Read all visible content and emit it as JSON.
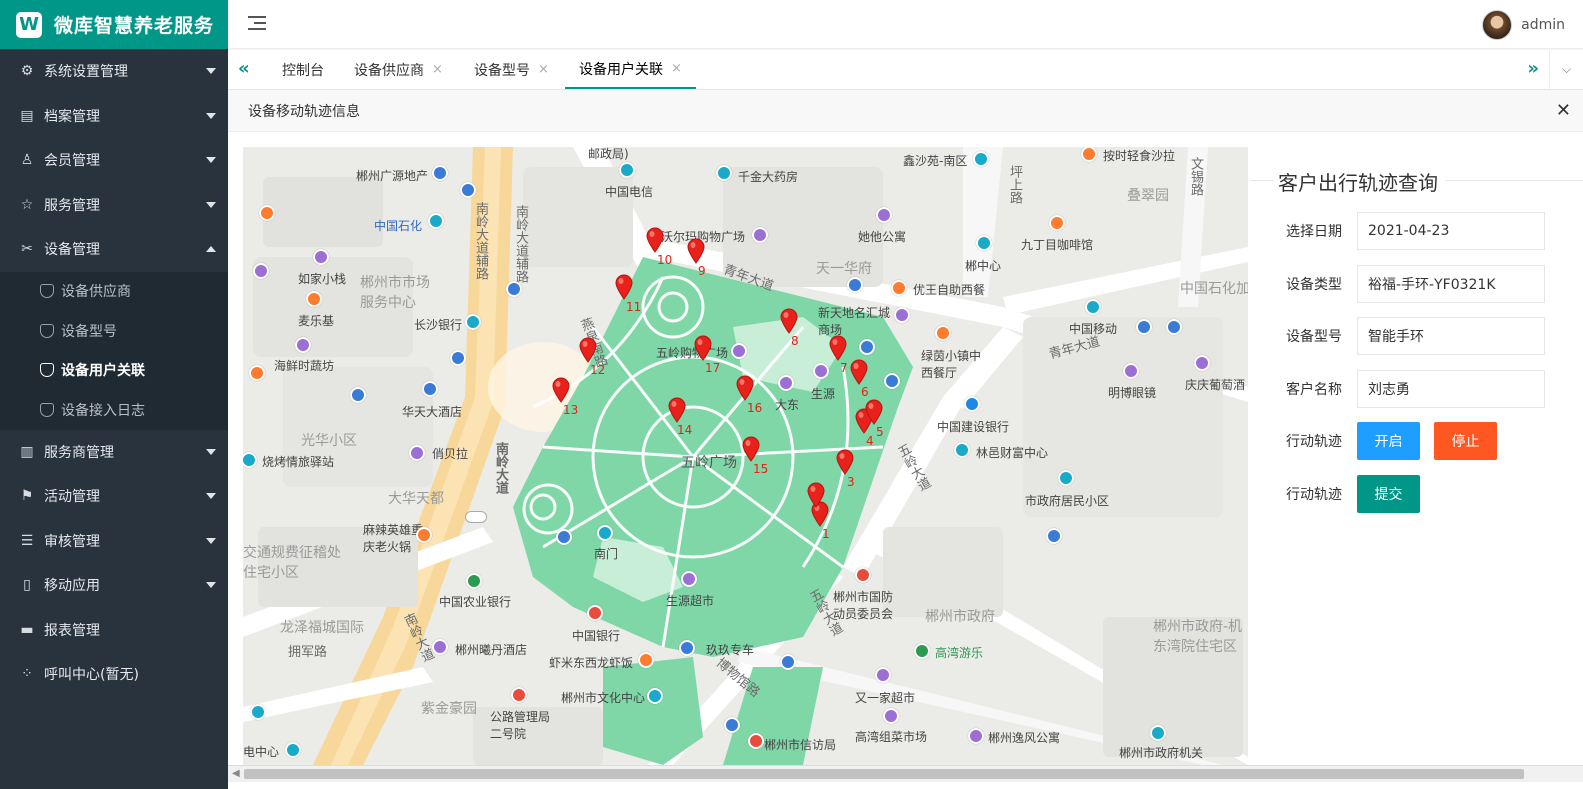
{
  "app": {
    "title": "微库智慧养老服务",
    "logo_letter": "W"
  },
  "sidebar": {
    "items": [
      {
        "label": "系统设置管理",
        "icon": "gear-icon"
      },
      {
        "label": "档案管理",
        "icon": "archive-icon"
      },
      {
        "label": "会员管理",
        "icon": "user-icon"
      },
      {
        "label": "服务管理",
        "icon": "star-icon"
      },
      {
        "label": "设备管理",
        "icon": "tools-icon"
      },
      {
        "label": "服务商管理",
        "icon": "document-icon"
      },
      {
        "label": "活动管理",
        "icon": "flag-icon"
      },
      {
        "label": "审核管理",
        "icon": "list-icon"
      },
      {
        "label": "移动应用",
        "icon": "mobile-icon"
      },
      {
        "label": "报表管理",
        "icon": "report-icon"
      },
      {
        "label": "呼叫中心(暂无)",
        "icon": "spinner-icon"
      }
    ],
    "submenu": [
      {
        "label": "设备供应商"
      },
      {
        "label": "设备型号"
      },
      {
        "label": "设备用户关联"
      },
      {
        "label": "设备接入日志"
      }
    ]
  },
  "header": {
    "user_name": "admin"
  },
  "tabs": [
    {
      "label": "控制台"
    },
    {
      "label": "设备供应商"
    },
    {
      "label": "设备型号"
    },
    {
      "label": "设备用户关联"
    }
  ],
  "panel": {
    "title": "设备移动轨迹信息"
  },
  "form": {
    "title": "客户出行轨迹查询",
    "date_label": "选择日期",
    "date_value": "2021-04-23",
    "type_label": "设备类型",
    "type_value": "裕福-手环-YF0321K",
    "model_label": "设备型号",
    "model_value": "智能手环",
    "customer_label": "客户名称",
    "customer_value": "刘志勇",
    "track_label": "行动轨迹",
    "start_btn": "开启",
    "stop_btn": "停止",
    "track_label2": "行动轨迹",
    "submit_btn": "提交"
  },
  "map": {
    "labels": [
      "邮政局)",
      "郴州广源地产",
      "中国电信",
      "千金大药房",
      "鑫沙苑-南区",
      "按时轻食沙拉",
      "中国石化",
      "南岭大道辅路",
      "南岭大道辅路",
      "沃尔玛购物广场",
      "她他公寓",
      "九丁目咖啡馆",
      "如家小栈",
      "郴州市市场服务中心",
      "天一华府",
      "郴中心",
      "中国石化加",
      "麦乐基",
      "长沙银行",
      "青年大道",
      "优王自助西餐",
      "新天地名汇城商场",
      "中国移动",
      "海鲜时蔬坊",
      "燕泉南路",
      "五岭购物广场",
      "绿茵小镇中西餐厅",
      "明博眼镜",
      "庆庆葡萄酒",
      "华天大酒店",
      "大东",
      "生源",
      "青年大道",
      "光华小区",
      "中国建设银行",
      "烧烤情旅驿站",
      "俏贝拉",
      "林邑财富中心",
      "南岭大道",
      "五岭广场",
      "大华天都",
      "市政府居民小区",
      "麻辣英雄重庆老火锅",
      "交通规费征稽处住宅小区",
      "南门",
      "中国农业银行",
      "郴州市国防动员委员会",
      "郴州市政府",
      "生源超市",
      "龙泽福城国际",
      "中国银行",
      "高湾游乐",
      "郴州市政府-机东湾院住宅区",
      "拥军路",
      "郴州曦丹酒店",
      "玖玖专车",
      "虾米东西龙虾饭",
      "又一家超市",
      "紫金豪园",
      "郴州市文化中心",
      "公路管理局二号院",
      "高湾组菜市场",
      "郴州逸风公寓",
      "郴州市信访局",
      "电中心",
      "郴州市政府机关",
      "博物馆路",
      "五岭大道",
      "五岭大道",
      "南岭大道",
      "叠翠园",
      "坪上路",
      "文锡路"
    ],
    "route_points": [
      "1",
      "2",
      "3",
      "4",
      "5",
      "6",
      "7",
      "8",
      "9",
      "10",
      "11",
      "12",
      "13",
      "14",
      "15",
      "16",
      "17"
    ]
  }
}
